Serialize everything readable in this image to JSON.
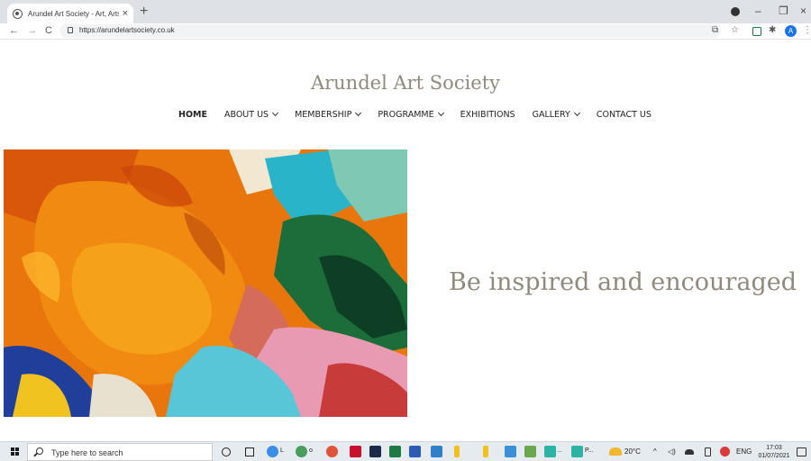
{
  "browser": {
    "tab_title": "Arundel Art Society - Art, Arts Or",
    "tab_close": "×",
    "new_tab": "+",
    "url": "https://arundelartsociety.co.uk",
    "avatar_initial": "A",
    "window_controls": {
      "minimize": "–",
      "maximize": "❐",
      "close": "×"
    },
    "nav": {
      "back": "←",
      "forward": "→",
      "reload": "C"
    },
    "toolbar_icons": {
      "share": "⧉",
      "star": "☆",
      "puzzle": "✱",
      "menu": "⋮"
    }
  },
  "site": {
    "title": "Arundel Art Society",
    "nav": [
      {
        "label": "HOME",
        "active": true,
        "dropdown": false
      },
      {
        "label": "ABOUT US",
        "active": false,
        "dropdown": true
      },
      {
        "label": "MEMBERSHIP",
        "active": false,
        "dropdown": true
      },
      {
        "label": "PROGRAMME",
        "active": false,
        "dropdown": true
      },
      {
        "label": "EXHIBITIONS",
        "active": false,
        "dropdown": false
      },
      {
        "label": "GALLERY",
        "active": false,
        "dropdown": true
      },
      {
        "label": "CONTACT US",
        "active": false,
        "dropdown": false
      }
    ],
    "tagline": "Be inspired and encouraged",
    "colors": {
      "heading": "#8f8a7d",
      "nav_text": "#222222"
    }
  },
  "taskbar": {
    "search_placeholder": "Type here to search",
    "app_labels": {
      "chrome1": "L",
      "chrome2": "o",
      "ppt1": "...",
      "ppt2": "P..."
    },
    "tray": {
      "temperature": "20°C",
      "language": "ENG"
    },
    "clock": {
      "time": "17:03",
      "date": "01/07/2021"
    }
  }
}
